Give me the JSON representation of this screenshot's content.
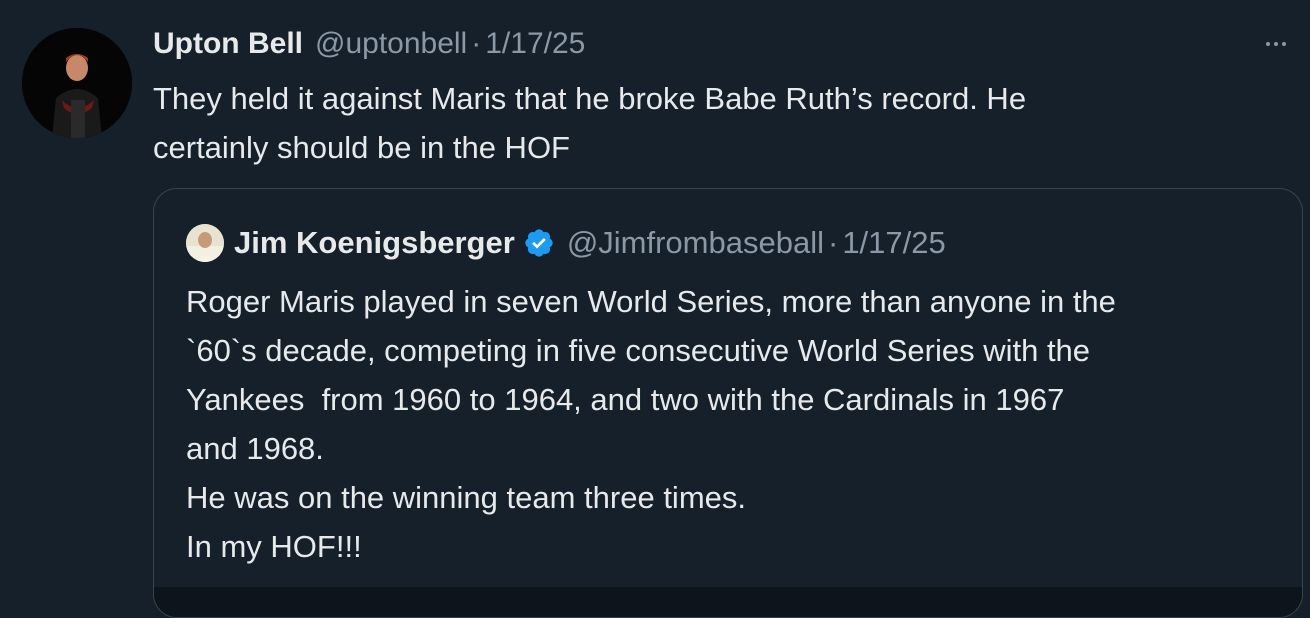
{
  "tweet": {
    "author_name": "Upton Bell",
    "author_handle": "@uptonbell",
    "separator": "·",
    "date": "1/17/25",
    "text": "They held it against Maris that he broke Babe Ruth’s record. He\ncertainly should be in the HOF",
    "more_icon": "more-horizontal-icon"
  },
  "quoted_tweet": {
    "author_name": "Jim Koenigsberger",
    "verified_icon": "verified-badge-icon",
    "author_handle": "@Jimfrombaseball",
    "separator": "·",
    "date": "1/17/25",
    "text": "Roger Maris played in seven World Series, more than anyone in the\n`60`s decade, competing in five consecutive World Series with the\nYankees  from 1960 to 1964, and two with the Cardinals in 1967\nand 1968.\nHe was on the winning team three times.\nIn my HOF!!!"
  },
  "colors": {
    "background": "#15202b",
    "text_primary": "#e7e9ea",
    "text_secondary": "#8b98a5",
    "border": "#38444d",
    "verified": "#1d9bf0"
  }
}
